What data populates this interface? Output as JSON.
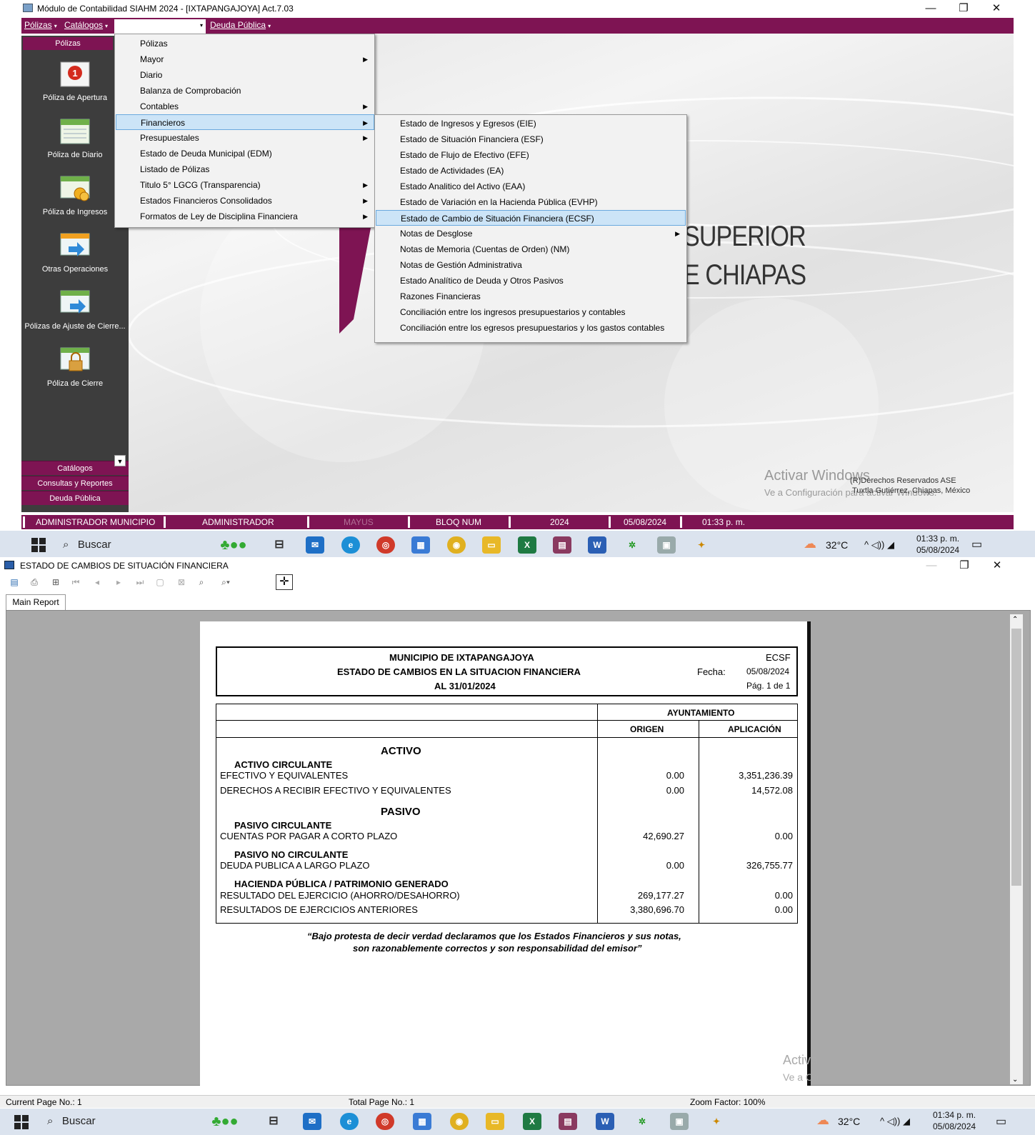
{
  "top_window": {
    "title": "Módulo de Contabilidad SIAHM 2024 - [IXTAPANGAJOYA] Act.7.03",
    "controls": [
      "—",
      "❐",
      "✕"
    ],
    "menubar": [
      "Pólizas",
      "Catálogos",
      "Deuda Pública"
    ],
    "sidebar": {
      "header": "Pólizas",
      "items": [
        "Póliza de Apertura",
        "Póliza de Diario",
        "Póliza de Ingresos",
        "Otras Operaciones",
        "Pólizas de Ajuste de Cierre...",
        "Póliza de Cierre"
      ],
      "categories": [
        "Catálogos",
        "Consultas y Reportes",
        "Deuda Pública"
      ]
    },
    "workspace": {
      "logo_text_1": "SUPERIOR",
      "logo_text_2": "E CHIAPAS",
      "activate_1": "Activar Windows",
      "activate_2": "Ve a Configuración para activar Windows.",
      "rights_1": "(R)Derechos Reservados ASE",
      "rights_2": "Tuxtla Gutiérrez, Chiapas, México"
    },
    "menu_reports": [
      {
        "label": "Pólizas",
        "submenu": false
      },
      {
        "label": "Mayor",
        "submenu": true
      },
      {
        "label": "Diario",
        "submenu": false
      },
      {
        "label": "Balanza de Comprobación",
        "submenu": false
      },
      {
        "label": "Contables",
        "submenu": true
      },
      {
        "label": "Financieros",
        "submenu": true
      },
      {
        "label": "Presupuestales",
        "submenu": true
      },
      {
        "label": "Estado de Deuda Municipal (EDM)",
        "submenu": false
      },
      {
        "label": "Listado de Pólizas",
        "submenu": false
      },
      {
        "label": "Titulo 5° LGCG (Transparencia)",
        "submenu": true
      },
      {
        "label": "Estados Financieros Consolidados",
        "submenu": true
      },
      {
        "label": "Formatos de Ley de Disciplina Financiera",
        "submenu": true
      }
    ],
    "menu_financieros": [
      {
        "label": "Estado de Ingresos y Egresos (EIE)",
        "submenu": false
      },
      {
        "label": "Estado de Situación Financiera (ESF)",
        "submenu": false
      },
      {
        "label": "Estado de Flujo de Efectivo (EFE)",
        "submenu": false
      },
      {
        "label": "Estado de Actividades (EA)",
        "submenu": false
      },
      {
        "label": "Estado Analitico del Activo (EAA)",
        "submenu": false
      },
      {
        "label": "Estado de Variación en la Hacienda Pública (EVHP)",
        "submenu": false
      },
      {
        "label": "Estado de Cambio de Situación Financiera (ECSF)",
        "submenu": false
      },
      {
        "label": "Notas de Desglose",
        "submenu": true
      },
      {
        "label": "Notas de Memoria (Cuentas de Orden) (NM)",
        "submenu": false
      },
      {
        "label": "Notas de Gestión Administrativa",
        "submenu": false
      },
      {
        "label": "Estado Analítico de Deuda y Otros Pasivos",
        "submenu": false
      },
      {
        "label": "Razones Financieras",
        "submenu": false
      },
      {
        "label": "Conciliación entre los ingresos presupuestarios y contables",
        "submenu": false
      },
      {
        "label": "Conciliación entre los egresos presupuestarios y los gastos contables",
        "submenu": false
      }
    ],
    "statusbar": [
      "ADMINISTRADOR MUNICIPIO",
      "ADMINISTRADOR",
      "MAYUS",
      "BLOQ NUM",
      "2024",
      "05/08/2024",
      "01:33 p. m."
    ]
  },
  "taskbar_top": {
    "search": "Buscar",
    "temp": "32°C",
    "time": "01:33 p. m.",
    "date": "05/08/2024"
  },
  "taskbar_bottom": {
    "search": "Buscar",
    "temp": "32°C",
    "time": "01:34 p. m.",
    "date": "05/08/2024"
  },
  "report_window": {
    "title": "ESTADO DE CAMBIOS DE SITUACIÓN FINANCIERA",
    "tab": "Main Report",
    "status_current": "Current Page No.: 1",
    "status_total": "Total Page No.: 1",
    "status_zoom": "Zoom Factor: 100%",
    "activate": "Activa",
    "activate2": "Ve a Co",
    "report": {
      "entity": "MUNICIPIO DE IXTAPANGAJOYA",
      "title": "ESTADO DE CAMBIOS EN LA SITUACION FINANCIERA",
      "period": "AL 31/01/2024",
      "code": "ECSF",
      "fecha_label": "Fecha:",
      "fecha": "05/08/2024",
      "page": "Pág. 1 de 1",
      "group_header": "AYUNTAMIENTO",
      "col_origen": "ORIGEN",
      "col_aplicacion": "APLICACIÓN",
      "sec_activo": "ACTIVO",
      "sub_activo_circ": "ACTIVO CIRCULANTE",
      "sec_pasivo": "PASIVO",
      "sub_pasivo_circ": "PASIVO CIRCULANTE",
      "sub_pasivo_nocirc": "PASIVO NO CIRCULANTE",
      "sub_hacienda": "HACIENDA PÚBLICA / PATRIMONIO GENERADO",
      "rows": [
        {
          "label": "EFECTIVO Y EQUIVALENTES",
          "origen": "0.00",
          "aplicacion": "3,351,236.39"
        },
        {
          "label": "DERECHOS A RECIBIR EFECTIVO Y EQUIVALENTES",
          "origen": "0.00",
          "aplicacion": "14,572.08"
        },
        {
          "label": "CUENTAS POR PAGAR A CORTO PLAZO",
          "origen": "42,690.27",
          "aplicacion": "0.00"
        },
        {
          "label": "DEUDA PUBLICA A LARGO PLAZO",
          "origen": "0.00",
          "aplicacion": "326,755.77"
        },
        {
          "label": "RESULTADO DEL EJERCICIO (AHORRO/DESAHORRO)",
          "origen": "269,177.27",
          "aplicacion": "0.00"
        },
        {
          "label": "RESULTADOS DE EJERCICIOS ANTERIORES",
          "origen": "3,380,696.70",
          "aplicacion": "0.00"
        }
      ],
      "footer_1": "“Bajo protesta de decir verdad declaramos que los Estados Financieros y sus notas,",
      "footer_2": "son razonablemente correctos y son responsabilidad del emisor”"
    }
  }
}
